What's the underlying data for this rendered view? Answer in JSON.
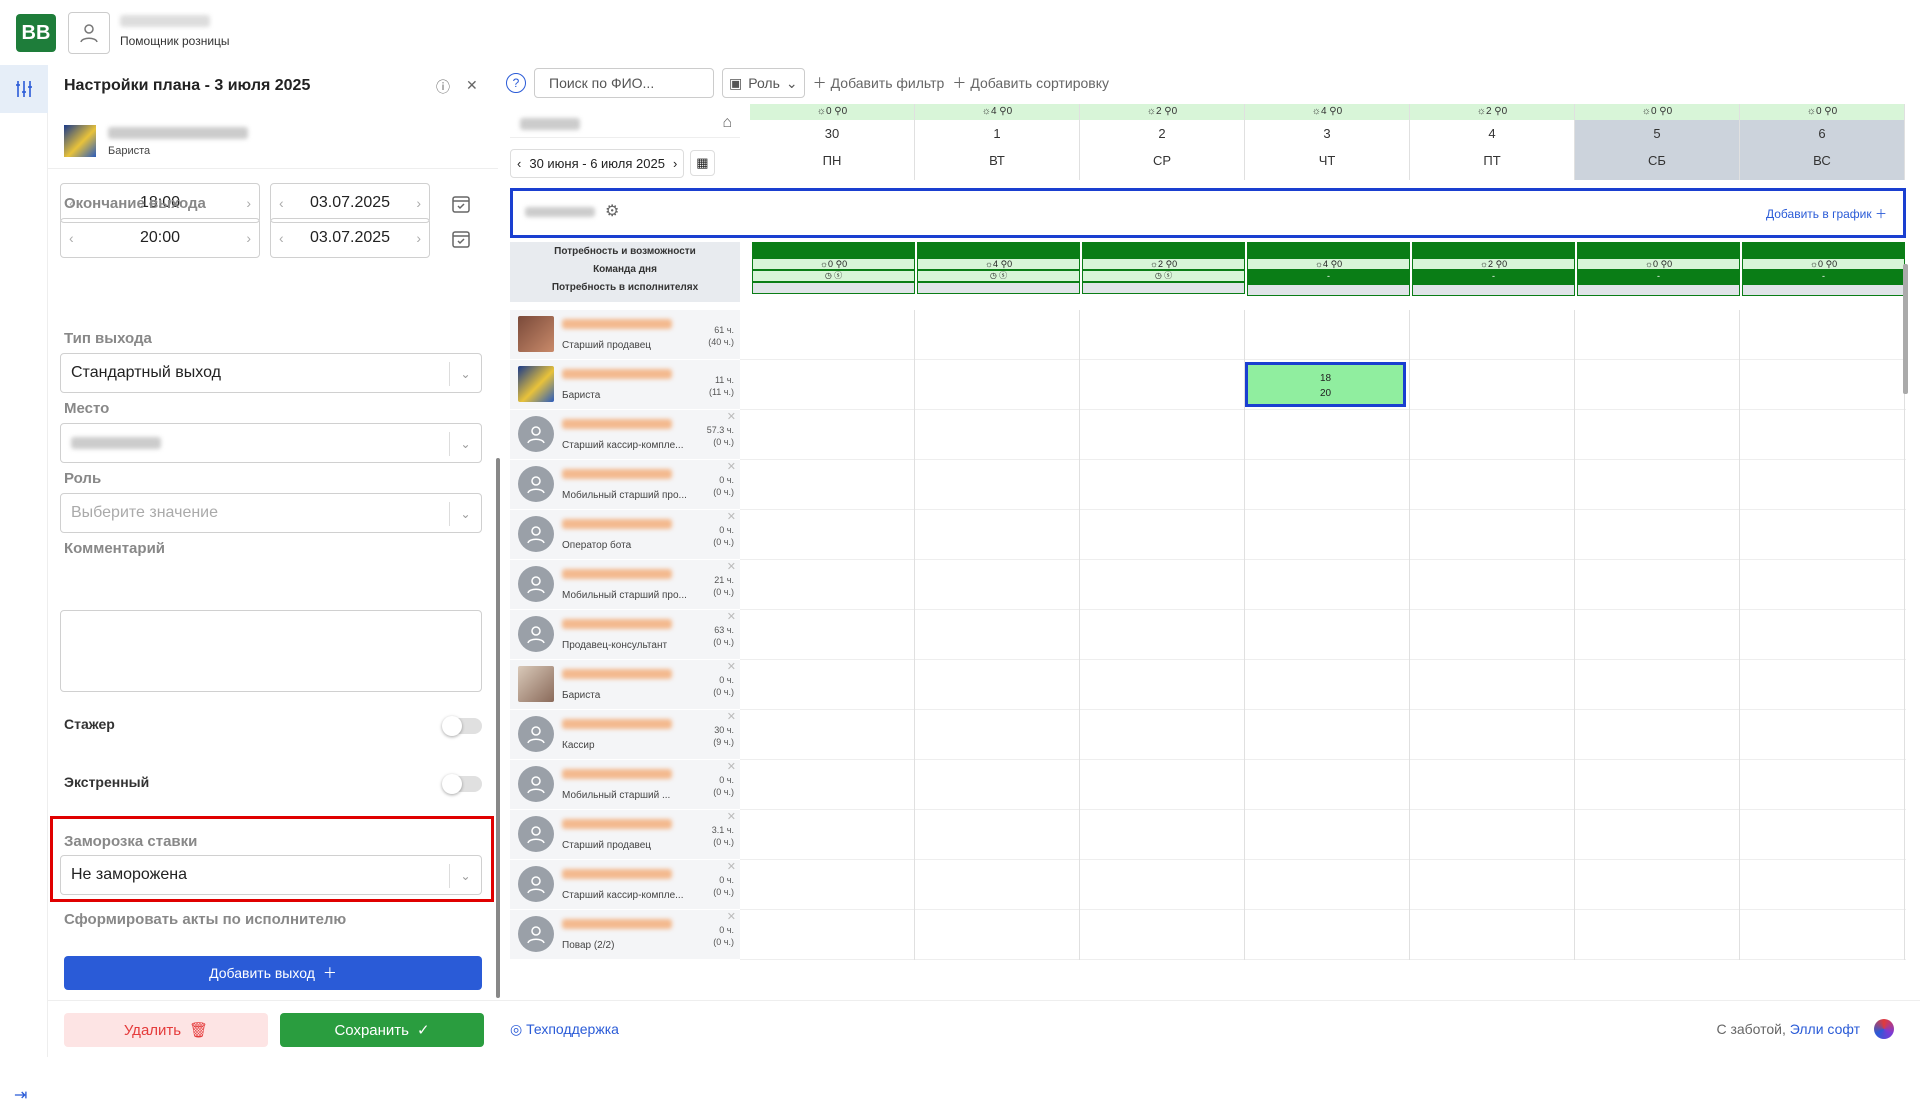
{
  "header": {
    "logo": "BB",
    "user_role": "Помощник розницы"
  },
  "panel": {
    "title": "Настройки плана - 3 июля 2025",
    "person_role": "Бариста",
    "start_time": "18:00",
    "start_date": "03.07.2025",
    "end_label": "Окончание выхода",
    "end_time": "20:00",
    "end_date": "03.07.2025",
    "type_label": "Тип выхода",
    "type_value": "Стандартный выход",
    "place_label": "Место",
    "role_label": "Роль",
    "role_placeholder": "Выберите значение",
    "comment_label": "Комментарий",
    "trainee_label": "Стажер",
    "emergency_label": "Экстренный",
    "freeze_label": "Заморозка ставки",
    "freeze_value": "Не заморожена",
    "acts_label": "Сформировать акты по исполнителю",
    "add_exit": "Добавить выход"
  },
  "footer": {
    "delete": "Удалить",
    "save": "Сохранить",
    "support": "Техподдержка",
    "credit": "С заботой,",
    "credit_link": "Элли софт"
  },
  "toolbar": {
    "search_placeholder": "Поиск по ФИО...",
    "role": "Роль",
    "add_filter": "Добавить фильтр",
    "add_sort": "Добавить сортировку"
  },
  "schedule": {
    "range": "30 июня - 6 июля 2025",
    "add_to_schedule": "Добавить в график",
    "need_labels": [
      "Потребность и возможности",
      "Команда дня",
      "Потребность в исполнителях"
    ],
    "days": [
      {
        "num": "30",
        "name": "ПН",
        "mini": "☼0 ⚲0",
        "weekend": false
      },
      {
        "num": "1",
        "name": "ВТ",
        "mini": "☼4 ⚲0",
        "weekend": false
      },
      {
        "num": "2",
        "name": "СР",
        "mini": "☼2 ⚲0",
        "weekend": false
      },
      {
        "num": "3",
        "name": "ЧТ",
        "mini": "☼4 ⚲0",
        "weekend": false
      },
      {
        "num": "4",
        "name": "ПТ",
        "mini": "☼2 ⚲0",
        "weekend": false
      },
      {
        "num": "5",
        "name": "СБ",
        "mini": "☼0 ⚲0",
        "weekend": true
      },
      {
        "num": "6",
        "name": "ВС",
        "mini": "☼0 ⚲0",
        "weekend": true
      }
    ],
    "people": [
      {
        "role": "Старший продавец",
        "hours": "61 ч.",
        "sub": "(40 ч.)",
        "photo": "photo1",
        "x": false
      },
      {
        "role": "Бариста",
        "hours": "11 ч.",
        "sub": "(11 ч.)",
        "photo": "photo2",
        "x": false
      },
      {
        "role": "Старший кассир-компле...",
        "hours": "57.3 ч.",
        "sub": "(0 ч.)",
        "photo": "avatar",
        "x": true
      },
      {
        "role": "Мобильный старший про...",
        "hours": "0 ч.",
        "sub": "(0 ч.)",
        "photo": "avatar",
        "x": true
      },
      {
        "role": "Оператор бота",
        "hours": "0 ч.",
        "sub": "(0 ч.)",
        "photo": "avatar",
        "x": true
      },
      {
        "role": "Мобильный старший про...",
        "hours": "21 ч.",
        "sub": "(0 ч.)",
        "photo": "avatar",
        "x": true
      },
      {
        "role": "Продавец-консультант",
        "hours": "63 ч.",
        "sub": "(0 ч.)",
        "photo": "avatar",
        "x": true
      },
      {
        "role": "Бариста",
        "hours": "0 ч.",
        "sub": "(0 ч.)",
        "photo": "photo3",
        "x": true
      },
      {
        "role": "Кассир",
        "hours": "30 ч.",
        "sub": "(9 ч.)",
        "photo": "avatar",
        "x": true
      },
      {
        "role": "Мобильный старший ...",
        "hours": "0 ч.",
        "sub": "(0 ч.)",
        "photo": "avatar",
        "x": true
      },
      {
        "role": "Старший продавец",
        "hours": "3.1 ч.",
        "sub": "(0 ч.)",
        "photo": "avatar",
        "x": true
      },
      {
        "role": "Старший кассир-компле...",
        "hours": "0 ч.",
        "sub": "(0 ч.)",
        "photo": "avatar",
        "x": true
      },
      {
        "role": "Повар (2/2)",
        "hours": "0 ч.",
        "sub": "(0 ч.)",
        "photo": "avatar",
        "x": true
      }
    ],
    "shift": {
      "start": "18",
      "end": "20"
    }
  },
  "colors": {
    "accent": "#2a5bd7",
    "green": "#0a7d16",
    "highlight": "#e00000"
  }
}
